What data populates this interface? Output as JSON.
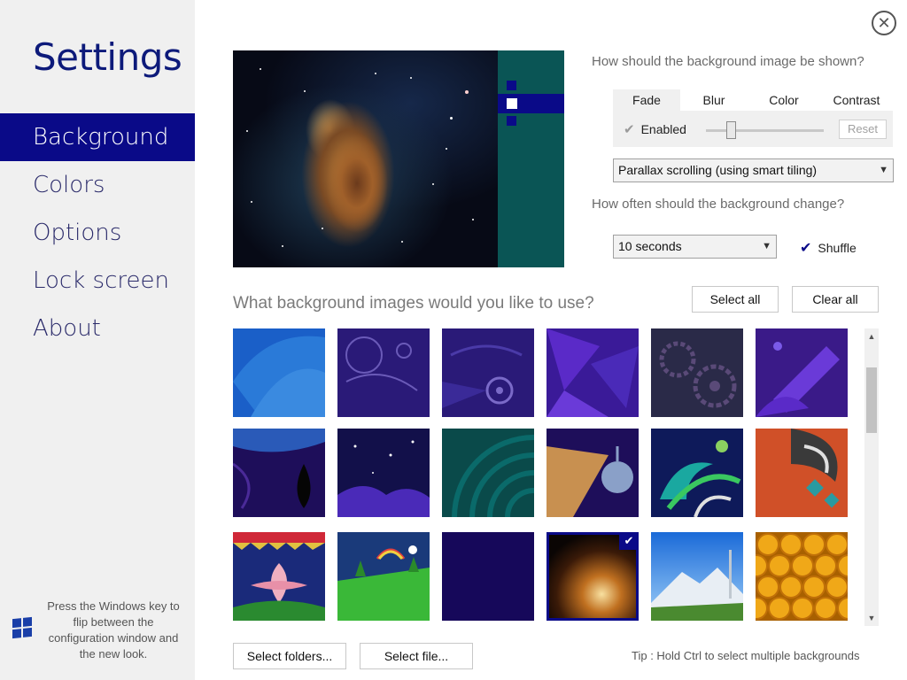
{
  "sidebar": {
    "title": "Settings",
    "items": [
      {
        "label": "Background",
        "active": true
      },
      {
        "label": "Colors",
        "active": false
      },
      {
        "label": "Options",
        "active": false
      },
      {
        "label": "Lock screen",
        "active": false
      },
      {
        "label": "About",
        "active": false
      }
    ],
    "hint": "Press the Windows key to flip between the configuration window and the new look."
  },
  "display": {
    "question": "How should the background image be shown?",
    "tabs": [
      "Fade",
      "Blur",
      "Color",
      "Contrast"
    ],
    "active_tab": "Fade",
    "enabled_label": "Enabled",
    "enabled_checked": true,
    "reset_label": "Reset",
    "mode_select": "Parallax scrolling (using smart tiling)"
  },
  "change": {
    "question": "How often should the background change?",
    "interval_select": "10 seconds",
    "shuffle_label": "Shuffle",
    "shuffle_checked": true
  },
  "images": {
    "question": "What background images would you like to use?",
    "select_all_label": "Select all",
    "clear_all_label": "Clear all",
    "select_folders_label": "Select folders...",
    "select_file_label": "Select file...",
    "tip": "Tip : Hold Ctrl to select multiple backgrounds"
  },
  "colors": {
    "accent": "#0a0a88",
    "panel": "#0a5555",
    "sidebar_bg": "#f0f0f0"
  },
  "icons": {
    "close": "close-circle-icon",
    "windows": "windows-logo-icon",
    "check": "checkmark-icon",
    "dropdown": "chevron-down-icon"
  }
}
